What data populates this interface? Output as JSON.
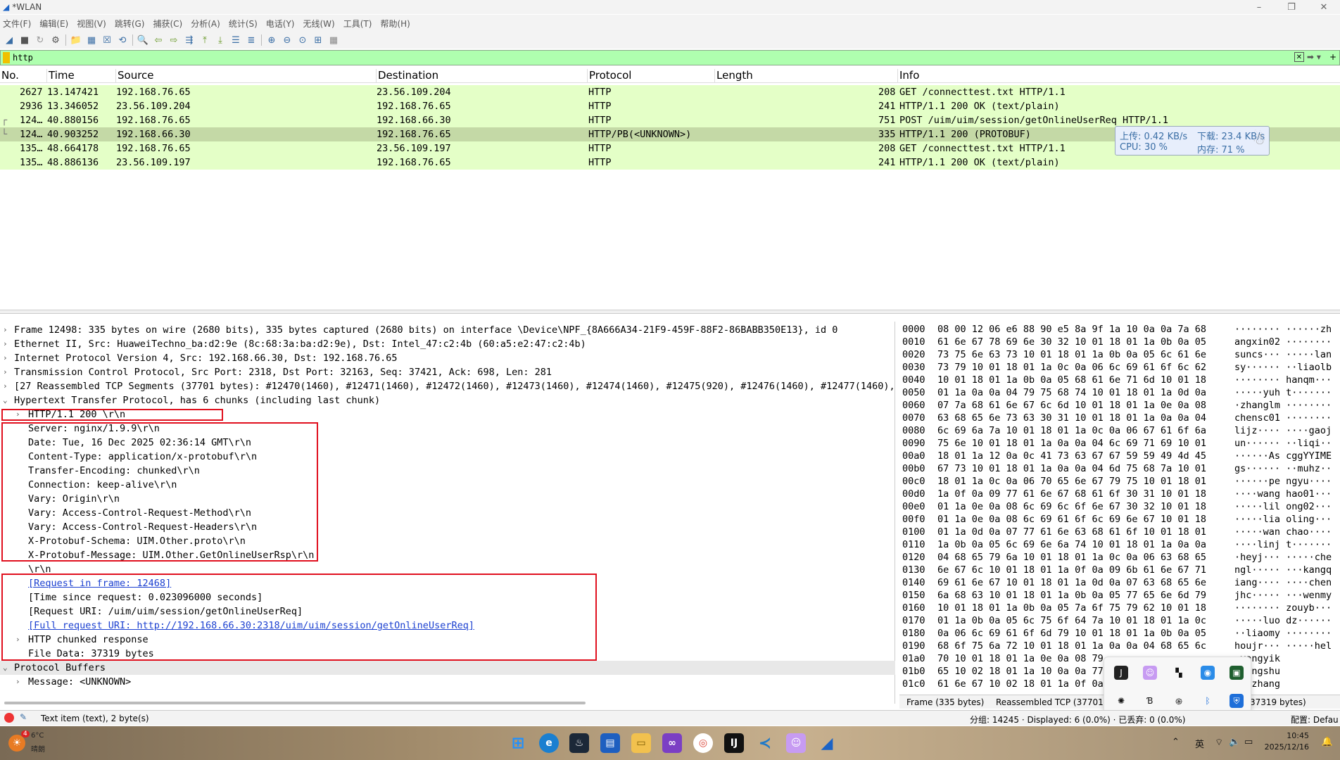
{
  "window": {
    "title": "*WLAN"
  },
  "menu": [
    "文件(F)",
    "编辑(E)",
    "视图(V)",
    "跳转(G)",
    "捕获(C)",
    "分析(A)",
    "统计(S)",
    "电话(Y)",
    "无线(W)",
    "工具(T)",
    "帮助(H)"
  ],
  "filter": {
    "value": "http"
  },
  "packet_list": {
    "headers": {
      "no": "No.",
      "time": "Time",
      "source": "Source",
      "destination": "Destination",
      "protocol": "Protocol",
      "length": "Length",
      "info": "Info"
    },
    "rows": [
      {
        "no": "2627",
        "time": "13.147421",
        "source": "192.168.76.65",
        "destination": "23.56.109.204",
        "protocol": "HTTP",
        "length": "208",
        "info": "GET /connecttest.txt HTTP/1.1"
      },
      {
        "no": "2936",
        "time": "13.346052",
        "source": "23.56.109.204",
        "destination": "192.168.76.65",
        "protocol": "HTTP",
        "length": "241",
        "info": "HTTP/1.1 200 OK  (text/plain)"
      },
      {
        "no": "124…",
        "time": "40.880156",
        "source": "192.168.76.65",
        "destination": "192.168.66.30",
        "protocol": "HTTP",
        "length": "751",
        "info": "POST /uim/uim/session/getOnlineUserReq HTTP/1.1"
      },
      {
        "no": "124…",
        "time": "40.903252",
        "source": "192.168.66.30",
        "destination": "192.168.76.65",
        "protocol": "HTTP/PB(<UNKNOWN>)",
        "length": "335",
        "info": "HTTP/1.1 200   (PROTOBUF)"
      },
      {
        "no": "135…",
        "time": "48.664178",
        "source": "192.168.76.65",
        "destination": "23.56.109.197",
        "protocol": "HTTP",
        "length": "208",
        "info": "GET /connecttest.txt HTTP/1.1"
      },
      {
        "no": "135…",
        "time": "48.886136",
        "source": "23.56.109.197",
        "destination": "192.168.76.65",
        "protocol": "HTTP",
        "length": "241",
        "info": "HTTP/1.1 200 OK  (text/plain)"
      }
    ]
  },
  "net_overlay": {
    "upload": "上传: 0.42 KB/s",
    "download": "下载: 23.4 KB/s",
    "cpu": "CPU: 30 %",
    "mem": "内存: 71 %"
  },
  "detail": [
    "Frame 12498: 335 bytes on wire (2680 bits), 335 bytes captured (2680 bits) on interface \\Device\\NPF_{8A666A34-21F9-459F-88F2-86BABB350E13}, id 0",
    "Ethernet II, Src: HuaweiTechno_ba:d2:9e (8c:68:3a:ba:d2:9e), Dst: Intel_47:c2:4b (60:a5:e2:47:c2:4b)",
    "Internet Protocol Version 4, Src: 192.168.66.30, Dst: 192.168.76.65",
    "Transmission Control Protocol, Src Port: 2318, Dst Port: 32163, Seq: 37421, Ack: 698, Len: 281",
    "[27 Reassembled TCP Segments (37701 bytes): #12470(1460), #12471(1460), #12472(1460), #12473(1460), #12474(1460), #12475(920), #12476(1460), #12477(1460), #",
    "Hypertext Transfer Protocol, has 6 chunks (including last chunk)",
    "HTTP/1.1 200 \\r\\n",
    "Server: nginx/1.9.9\\r\\n",
    "Date: Tue, 16 Dec 2025 02:36:14 GMT\\r\\n",
    "Content-Type: application/x-protobuf\\r\\n",
    "Transfer-Encoding: chunked\\r\\n",
    "Connection: keep-alive\\r\\n",
    "Vary: Origin\\r\\n",
    "Vary: Access-Control-Request-Method\\r\\n",
    "Vary: Access-Control-Request-Headers\\r\\n",
    "X-Protobuf-Schema: UIM.Other.proto\\r\\n",
    "X-Protobuf-Message: UIM.Other.GetOnlineUserRsp\\r\\n",
    "\\r\\n",
    "[Request in frame: 12468]",
    "[Time since request: 0.023096000 seconds]",
    "[Request URI: /uim/uim/session/getOnlineUserReq]",
    "[Full request URI: http://192.168.66.30:2318/uim/uim/session/getOnlineUserReq]",
    "HTTP chunked response",
    "File Data: 37319 bytes",
    "Protocol Buffers",
    "Message: <UNKNOWN>"
  ],
  "bytes": [
    {
      "off": "0000",
      "hex": "08 00 12 06 e6 88 90 e5  8a 9f 1a 10 0a 0a 7a 68",
      "asc": "········ ······zh"
    },
    {
      "off": "0010",
      "hex": "61 6e 67 78 69 6e 30 32  10 01 18 01 1a 0b 0a 05",
      "asc": "angxin02 ········"
    },
    {
      "off": "0020",
      "hex": "73 75 6e 63 73 10 01 18  01 1a 0b 0a 05 6c 61 6e",
      "asc": "suncs··· ·····lan"
    },
    {
      "off": "0030",
      "hex": "73 79 10 01 18 01 1a 0c  0a 06 6c 69 61 6f 6c 62",
      "asc": "sy······ ··liaolb"
    },
    {
      "off": "0040",
      "hex": "10 01 18 01 1a 0b 0a 05  68 61 6e 71 6d 10 01 18",
      "asc": "········ hanqm···"
    },
    {
      "off": "0050",
      "hex": "01 1a 0a 0a 04 79 75 68  74 10 01 18 01 1a 0d 0a",
      "asc": "·····yuh t·······"
    },
    {
      "off": "0060",
      "hex": "07 7a 68 61 6e 67 6c 6d  10 01 18 01 1a 0e 0a 08",
      "asc": "·zhanglm ········"
    },
    {
      "off": "0070",
      "hex": "63 68 65 6e 73 63 30 31  10 01 18 01 1a 0a 0a 04",
      "asc": "chensc01 ········"
    },
    {
      "off": "0080",
      "hex": "6c 69 6a 7a 10 01 18 01  1a 0c 0a 06 67 61 6f 6a",
      "asc": "lijz···· ····gaoj"
    },
    {
      "off": "0090",
      "hex": "75 6e 10 01 18 01 1a 0a  0a 04 6c 69 71 69 10 01",
      "asc": "un······ ··liqi··"
    },
    {
      "off": "00a0",
      "hex": "18 01 1a 12 0a 0c 41 73  63 67 67 59 59 49 4d 45",
      "asc": "······As cggYYIME"
    },
    {
      "off": "00b0",
      "hex": "67 73 10 01 18 01 1a 0a  0a 04 6d 75 68 7a 10 01",
      "asc": "gs······ ··muhz··"
    },
    {
      "off": "00c0",
      "hex": "18 01 1a 0c 0a 06 70 65  6e 67 79 75 10 01 18 01",
      "asc": "······pe ngyu····"
    },
    {
      "off": "00d0",
      "hex": "1a 0f 0a 09 77 61 6e 67  68 61 6f 30 31 10 01 18",
      "asc": "····wang hao01···"
    },
    {
      "off": "00e0",
      "hex": "01 1a 0e 0a 08 6c 69 6c  6f 6e 67 30 32 10 01 18",
      "asc": "·····lil ong02···"
    },
    {
      "off": "00f0",
      "hex": "01 1a 0e 0a 08 6c 69 61  6f 6c 69 6e 67 10 01 18",
      "asc": "·····lia oling···"
    },
    {
      "off": "0100",
      "hex": "01 1a 0d 0a 07 77 61 6e  63 68 61 6f 10 01 18 01",
      "asc": "·····wan chao····"
    },
    {
      "off": "0110",
      "hex": "1a 0b 0a 05 6c 69 6e 6a  74 10 01 18 01 1a 0a 0a",
      "asc": "····linj t·······"
    },
    {
      "off": "0120",
      "hex": "04 68 65 79 6a 10 01 18  01 1a 0c 0a 06 63 68 65",
      "asc": "·heyj··· ·····che"
    },
    {
      "off": "0130",
      "hex": "6e 67 6c 10 01 18 01 1a  0f 0a 09 6b 61 6e 67 71",
      "asc": "ngl····· ···kangq"
    },
    {
      "off": "0140",
      "hex": "69 61 6e 67 10 01 18 01  1a 0d 0a 07 63 68 65 6e",
      "asc": "iang···· ····chen"
    },
    {
      "off": "0150",
      "hex": "6a 68 63 10 01 18 01 1a  0b 0a 05 77 65 6e 6d 79",
      "asc": "jhc····· ···wenmy"
    },
    {
      "off": "0160",
      "hex": "10 01 18 01 1a 0b 0a 05  7a 6f 75 79 62 10 01 18",
      "asc": "········ zouyb···"
    },
    {
      "off": "0170",
      "hex": "01 1a 0b 0a 05 6c 75 6f  64 7a 10 01 18 01 1a 0c",
      "asc": "·····luo dz······"
    },
    {
      "off": "0180",
      "hex": "0a 06 6c 69 61 6f 6d 79  10 01 18 01 1a 0b 0a 05",
      "asc": "··liaomy ········"
    },
    {
      "off": "0190",
      "hex": "68 6f 75 6a 72 10 01 18  01 1a 0a 0a 04 68 65 6c",
      "asc": "houjr··· ·····hel"
    },
    {
      "off": "01a0",
      "hex": "70 10 01 18 01 1a 0e 0a  08 79",
      "asc": "·yangyik"
    },
    {
      "off": "01b0",
      "hex": "65 10 02 18 01 1a 10 0a  0a 77",
      "asc": "·wangshu"
    },
    {
      "off": "01c0",
      "hex": "61 6e 67 10 02 18 01 1a  0f 0a",
      "asc": "···zhang"
    }
  ],
  "bytes_tabs": [
    "Frame (335 bytes)",
    "Reassembled TCP (37701 b",
    "37319 bytes)"
  ],
  "status": {
    "left": "Text item (text), 2 byte(s)",
    "middle": "分组: 14245 · Displayed: 6 (0.0%) · 已丢弃: 0 (0.0%)",
    "right": "配置: Defau"
  },
  "taskbar": {
    "weather_badge": "4",
    "weather_temp": "6°C",
    "weather_text": "晴朗",
    "lang": "英",
    "time": "10:45",
    "date": "2025/12/16"
  },
  "colors": {
    "http_row": "#e4ffc7",
    "selected_row": "#c4d9a6",
    "filter_ok": "#afffaf",
    "highlight_box": "#e0101e",
    "link": "#1a3fd0"
  }
}
